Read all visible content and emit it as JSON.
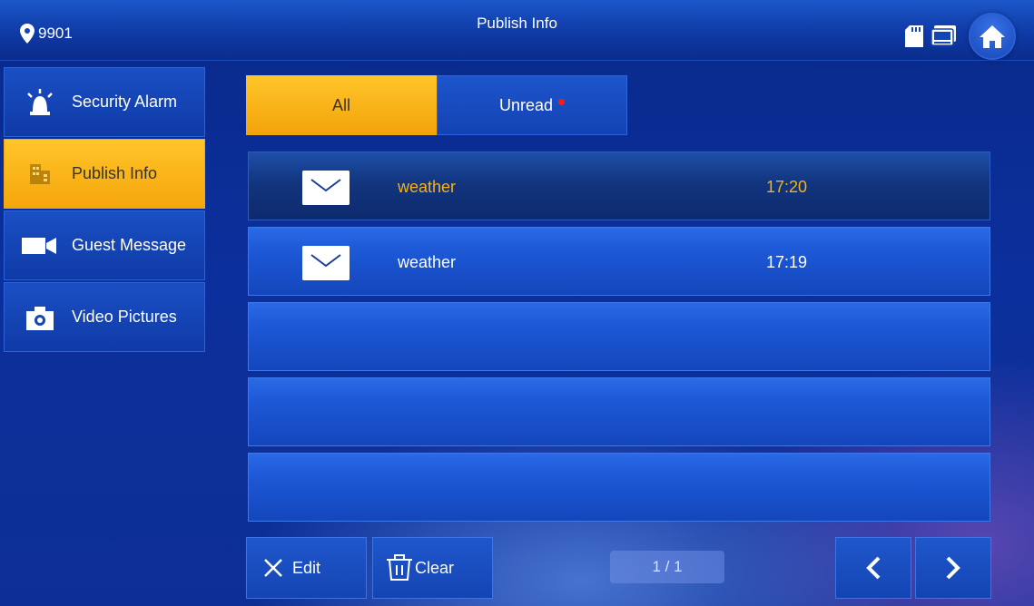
{
  "header": {
    "location_code": "9901",
    "title": "Publish Info",
    "icons": [
      "location-pin-icon",
      "sd-card-icon",
      "panel-icon",
      "home-icon"
    ]
  },
  "sidebar": {
    "items": [
      {
        "label": "Security Alarm",
        "icon": "alarm-icon",
        "active": false
      },
      {
        "label": "Publish Info",
        "icon": "building-icon",
        "active": true
      },
      {
        "label": "Guest Message",
        "icon": "video-camera-icon",
        "active": false
      },
      {
        "label": "Video Pictures",
        "icon": "camera-icon",
        "active": false
      }
    ]
  },
  "tabs": {
    "all_label": "All",
    "unread_label": "Unread",
    "active": "All"
  },
  "messages": [
    {
      "subject": "weather",
      "time": "17:20",
      "selected": true
    },
    {
      "subject": "weather",
      "time": "17:19",
      "selected": false
    }
  ],
  "footer": {
    "edit_label": "Edit",
    "clear_label": "Clear",
    "page_indicator": "1 / 1"
  },
  "colors": {
    "accent_yellow": "#f5a60c",
    "selected_text": "#f5b21a",
    "unread_dot": "#ff1a1a",
    "background_blue": "#0b2f9c"
  }
}
